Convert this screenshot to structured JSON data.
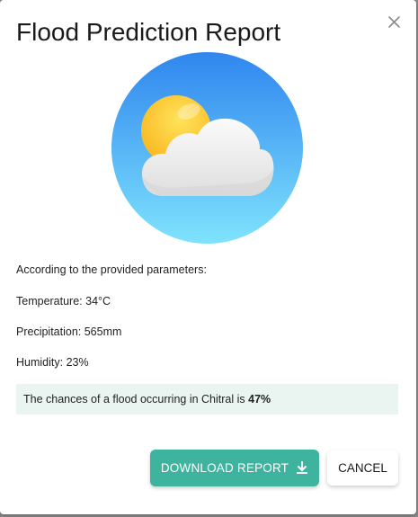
{
  "dialog": {
    "title": "Flood Prediction Report",
    "close_icon": "close-icon",
    "weather_icon": "partly-cloudy-icon"
  },
  "report": {
    "intro": "According to the provided parameters:",
    "temperature": "Temperature: 34°C",
    "precipitation": "Precipitation: 565mm",
    "humidity": "Humidity: 23%",
    "result_prefix": "The chances of a flood occurring in Chitral is ",
    "result_value": "47%"
  },
  "actions": {
    "download_label": "DOWNLOAD REPORT",
    "download_icon": "download-icon",
    "cancel_label": "CANCEL"
  },
  "colors": {
    "accent": "#3eb49f",
    "result_background": "#eaf5f2",
    "sky_top": "#2f86ee",
    "sky_bottom": "#7fe3fd",
    "sun": "#fcc72b"
  }
}
